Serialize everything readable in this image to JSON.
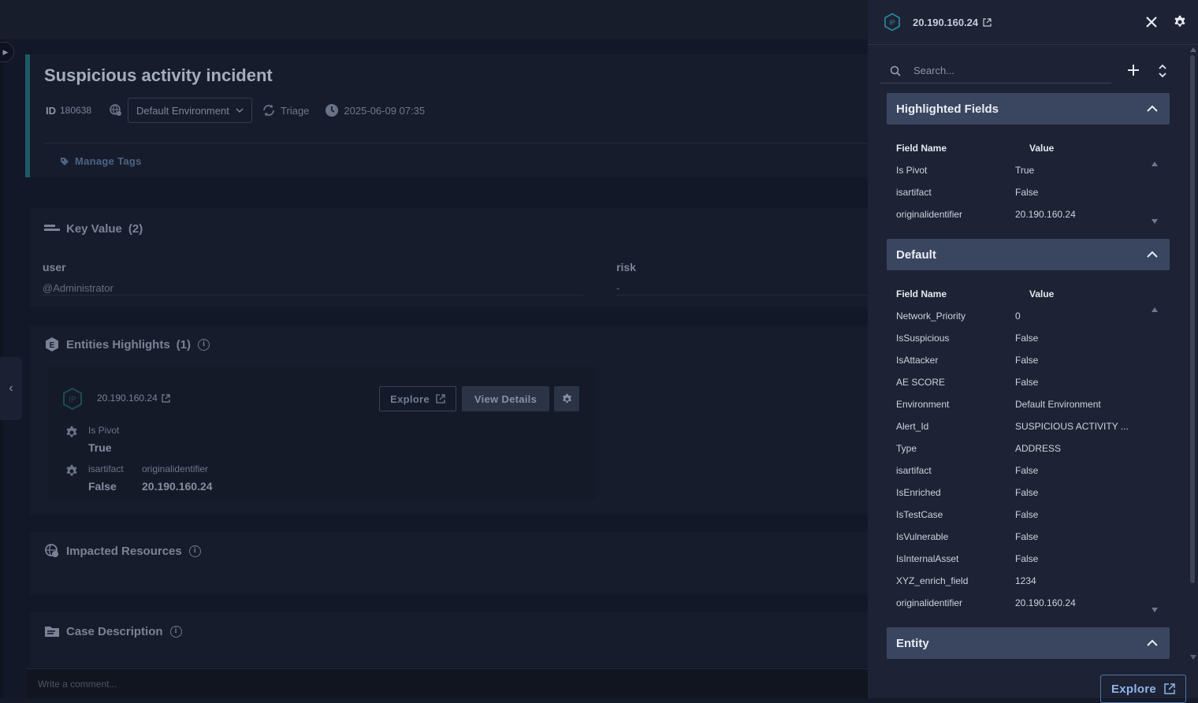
{
  "case": {
    "title": "Suspicious activity incident",
    "id_label": "ID",
    "id_value": "180638",
    "environment": "Default Environment",
    "stage": "Triage",
    "timestamp": "2025-06-09 07:35",
    "manage_tags": "Manage Tags"
  },
  "key_value": {
    "title": "Key Value",
    "count": "(2)",
    "items": [
      {
        "key": "user",
        "value": "@Administrator"
      },
      {
        "key": "risk",
        "value": "-"
      }
    ]
  },
  "entities_highlights": {
    "title": "Entities Highlights",
    "count": "(1)",
    "entity": {
      "badge": "IP",
      "name": "20.190.160.24",
      "explore_label": "Explore",
      "view_details_label": "View Details",
      "props": [
        {
          "label": "Is Pivot",
          "value": "True"
        },
        {
          "label": "isartifact",
          "value": "False"
        },
        {
          "label": "originalidentifier",
          "value": "20.190.160.24"
        }
      ]
    }
  },
  "impacted_resources": {
    "title": "Impacted Resources"
  },
  "case_description": {
    "title": "Case Description"
  },
  "comment": {
    "placeholder": "Write a comment..."
  },
  "panel": {
    "badge": "IP",
    "title": "20.190.160.24",
    "search_placeholder": "Search...",
    "col_field": "Field Name",
    "col_value": "Value",
    "explore_label": "Explore",
    "sections": {
      "highlighted": {
        "title": "Highlighted Fields",
        "rows": [
          {
            "name": "Is Pivot",
            "value": "True"
          },
          {
            "name": "isartifact",
            "value": "False"
          },
          {
            "name": "originalidentifier",
            "value": "20.190.160.24"
          }
        ]
      },
      "default": {
        "title": "Default",
        "rows": [
          {
            "name": "Network_Priority",
            "value": "0"
          },
          {
            "name": "IsSuspicious",
            "value": "False"
          },
          {
            "name": "IsAttacker",
            "value": "False"
          },
          {
            "name": "AE SCORE",
            "value": "False"
          },
          {
            "name": "Environment",
            "value": "Default Environment"
          },
          {
            "name": "Alert_Id",
            "value": "SUSPICIOUS ACTIVITY ..."
          },
          {
            "name": "Type",
            "value": "ADDRESS"
          },
          {
            "name": "isartifact",
            "value": "False"
          },
          {
            "name": "IsEnriched",
            "value": "False"
          },
          {
            "name": "IsTestCase",
            "value": "False"
          },
          {
            "name": "IsVulnerable",
            "value": "False"
          },
          {
            "name": "IsInternalAsset",
            "value": "False"
          },
          {
            "name": "XYZ_enrich_field",
            "value": "1234"
          },
          {
            "name": "originalidentifier",
            "value": "20.190.160.24"
          }
        ]
      },
      "entity": {
        "title": "Entity"
      }
    }
  },
  "colors": {
    "accent": "#1f5a67",
    "panel_bg": "#1d2334",
    "section_header": "#3a4560",
    "link_blue": "#8fb3ea"
  },
  "icons": [
    "external-link-icon",
    "close-icon",
    "gear-icon",
    "search-icon",
    "plus-icon",
    "expand-collapse-icon",
    "chevron-up-icon",
    "ip-hexagon-icon",
    "tag-icon",
    "clock-icon",
    "sync-icon",
    "info-icon"
  ]
}
